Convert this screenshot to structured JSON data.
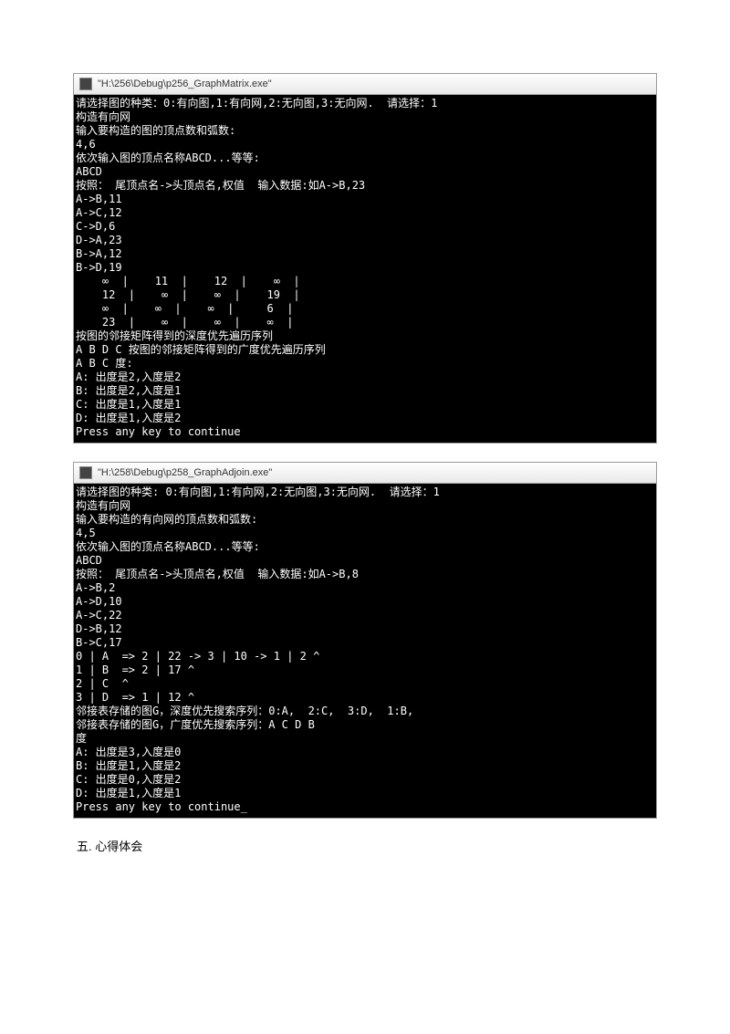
{
  "window1": {
    "title": "\"H:\\256\\Debug\\p256_GraphMatrix.exe\"",
    "lines": [
      "请选择图的种类：0:有向图,1:有向网,2:无向图,3:无向网.  请选择：1",
      "构造有向网",
      "输入要构造的图的顶点数和弧数:",
      "4,6",
      "依次输入图的顶点名称ABCD...等等:",
      "ABCD",
      "按照： 尾顶点名->头顶点名,权值  输入数据:如A->B,23",
      "A->B,11",
      "A->C,12",
      "C->D,6",
      "D->A,23",
      "B->A,12",
      "B->D,19",
      "    ∞  |    11  |    12  |    ∞  |",
      "    12  |    ∞  |    ∞  |    19  |",
      "    ∞  |    ∞  |    ∞  |     6  |",
      "    23  |    ∞  |    ∞  |    ∞  |",
      "按图的邻接矩阵得到的深度优先遍历序列",
      "A B D C 按图的邻接矩阵得到的广度优先遍历序列",
      "A B C 度:",
      "A: 出度是2,入度是2",
      "B: 出度是2,入度是1",
      "C: 出度是1,入度是1",
      "D: 出度是1,入度是2",
      "Press any key to continue"
    ]
  },
  "window2": {
    "title": "\"H:\\258\\Debug\\p258_GraphAdjoin.exe\"",
    "lines": [
      "请选择图的种类: 0:有向图,1:有向网,2:无向图,3:无向网.  请选择：1",
      "构造有向网",
      "输入要构造的有向网的顶点数和弧数:",
      "4,5",
      "依次输入图的顶点名称ABCD...等等:",
      "ABCD",
      "按照： 尾顶点名->头顶点名,权值  输入数据:如A->B,8",
      "A->B,2",
      "A->D,10",
      "A->C,22",
      "D->B,12",
      "B->C,17",
      "0 | A  => 2 | 22 -> 3 | 10 -> 1 | 2 ^",
      "1 | B  => 2 | 17 ^",
      "2 | C  ^",
      "3 | D  => 1 | 12 ^",
      "邻接表存储的图G，深度优先搜索序列：0:A,  2:C,  3:D,  1:B,",
      "邻接表存储的图G，广度优先搜索序列：A C D B",
      "度",
      "A: 出度是3,入度是0",
      "B: 出度是1,入度是2",
      "C: 出度是0,入度是2",
      "D: 出度是1,入度是1",
      "Press any key to continue_"
    ]
  },
  "footer": "五. 心得体会"
}
